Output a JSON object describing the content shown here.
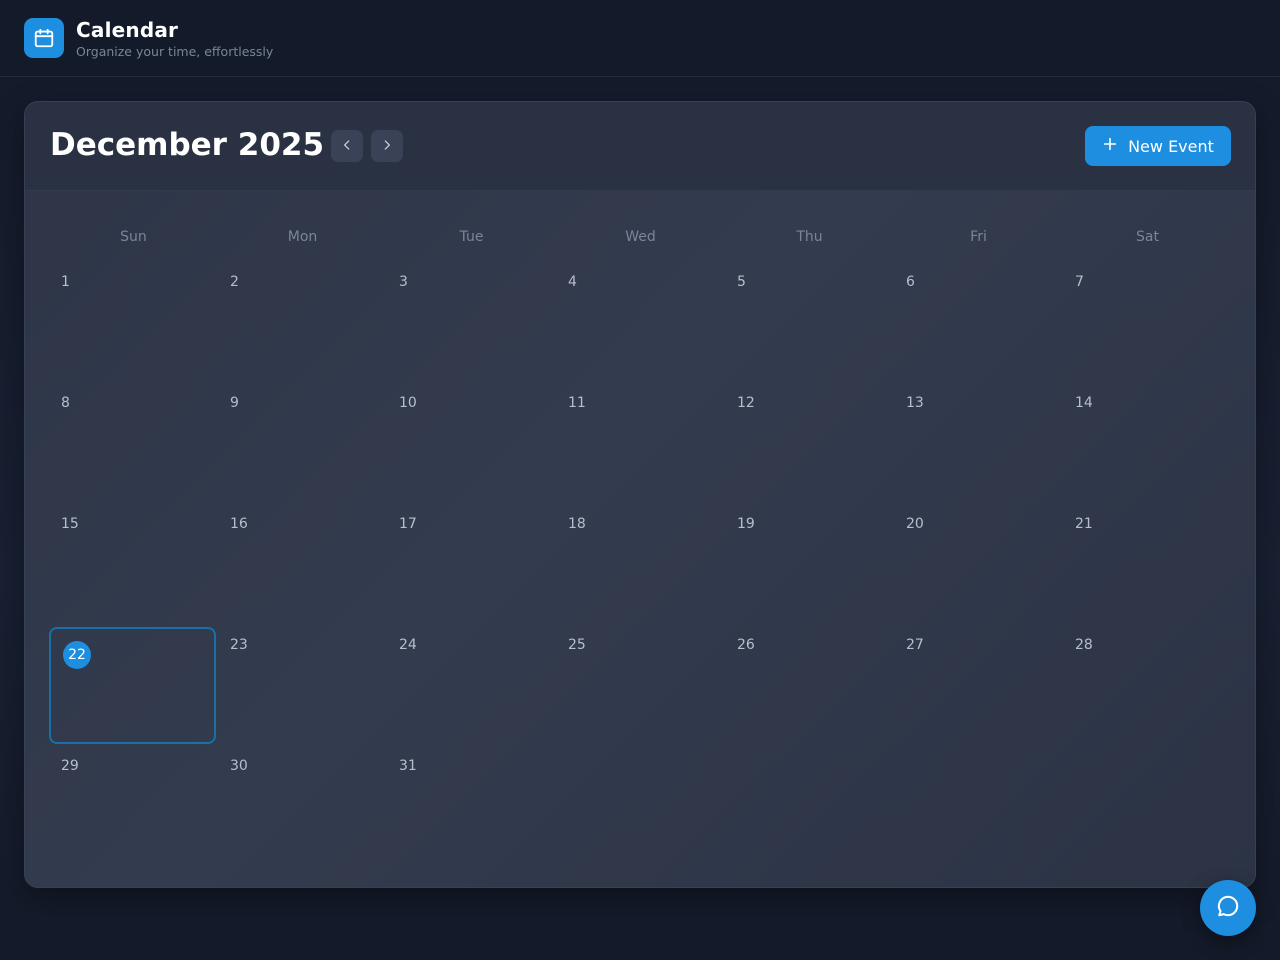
{
  "app": {
    "title": "Calendar",
    "subtitle": "Organize your time, effortlessly"
  },
  "calendar": {
    "month_title": "December 2025",
    "new_event_label": "New Event",
    "weekdays": [
      "Sun",
      "Mon",
      "Tue",
      "Wed",
      "Thu",
      "Fri",
      "Sat"
    ],
    "today": "22",
    "days": [
      "1",
      "2",
      "3",
      "4",
      "5",
      "6",
      "7",
      "8",
      "9",
      "10",
      "11",
      "12",
      "13",
      "14",
      "15",
      "16",
      "17",
      "18",
      "19",
      "20",
      "21",
      "22",
      "23",
      "24",
      "25",
      "26",
      "27",
      "28",
      "29",
      "30",
      "31"
    ]
  },
  "icons": {
    "app": "calendar-icon",
    "prev": "chevron-left-icon",
    "next": "chevron-right-icon",
    "add": "plus-icon",
    "fab": "chat-bubble-icon"
  },
  "colors": {
    "accent": "#1e8ee0",
    "today_outline": "#1a6fa8",
    "background": "#151b2b",
    "panel": "#2d3547"
  }
}
